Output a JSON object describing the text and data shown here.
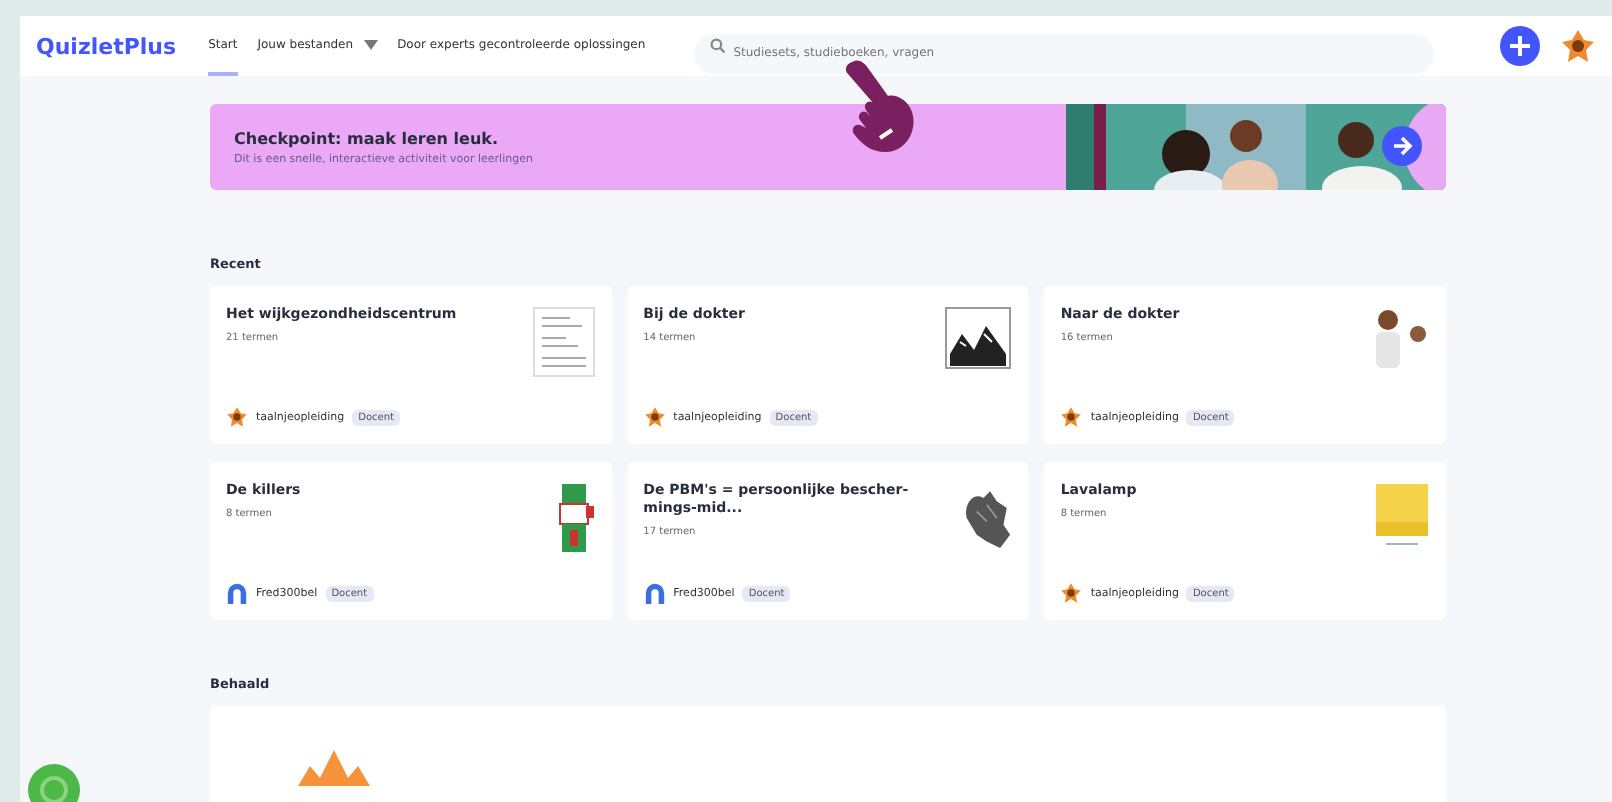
{
  "header": {
    "logo": "QuizletPlus",
    "nav": [
      {
        "label": "Start",
        "selected": true,
        "dropdown": false
      },
      {
        "label": "Jouw bestanden",
        "selected": false,
        "dropdown": true
      },
      {
        "label": "Door experts gecontroleerde oplossingen",
        "selected": false,
        "dropdown": false
      }
    ],
    "search": {
      "placeholder": "Studiesets, studieboeken, vragen"
    }
  },
  "banner": {
    "title": "Checkpoint: maak leren leuk.",
    "subtitle": "Dit is een snelle, interactieve activiteit voor leerlingen"
  },
  "recent": {
    "heading": "Recent",
    "cards": [
      {
        "title": "Het wijkgezondheidscentrum",
        "count": "21 termen",
        "author": "taalnjeopleiding",
        "badge": "Docent",
        "kind": "star"
      },
      {
        "title": "Bij de dokter",
        "count": "14 termen",
        "author": "taalnjeopleiding",
        "badge": "Docent",
        "kind": "star"
      },
      {
        "title": "Naar de dokter",
        "count": "16 termen",
        "author": "taalnjeopleiding",
        "badge": "Docent",
        "kind": "star"
      },
      {
        "title": "De killers",
        "count": "8 termen",
        "author": "Fred300bel",
        "badge": "Docent",
        "kind": "arch"
      },
      {
        "title": "De PBM's = persoonlijke bescher-mings-mid...",
        "count": "17 termen",
        "author": "Fred300bel",
        "badge": "Docent",
        "kind": "arch"
      },
      {
        "title": "Lavalamp",
        "count": "8 termen",
        "author": "taalnjeopleiding",
        "badge": "Docent",
        "kind": "star"
      }
    ]
  },
  "achieved": {
    "heading": "Behaald"
  }
}
